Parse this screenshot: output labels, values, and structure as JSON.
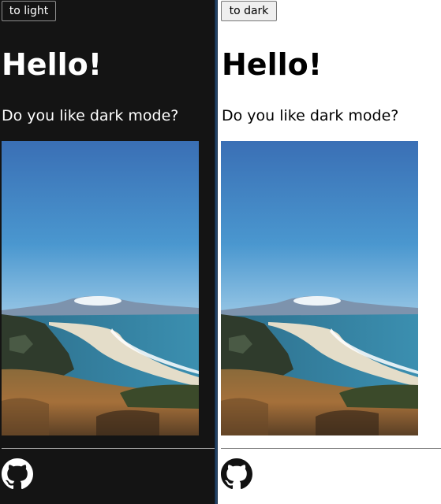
{
  "dark_panel": {
    "toggle_label": "to light",
    "heading": "Hello!",
    "question": "Do you like dark mode?",
    "background": "#141414",
    "text_color": "#ffffff"
  },
  "light_panel": {
    "toggle_label": "to dark",
    "heading": "Hello!",
    "question": "Do you like dark mode?",
    "background": "#ffffff",
    "text_color": "#000000"
  },
  "photo": {
    "icon": "coastal-landscape-photo"
  },
  "footer": {
    "icon": "github-icon"
  }
}
